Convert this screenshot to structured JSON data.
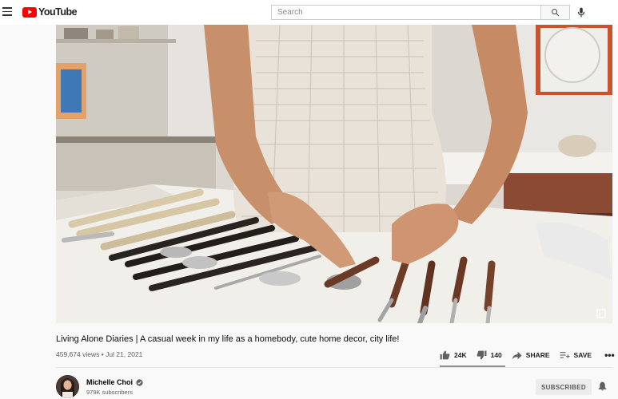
{
  "header": {
    "logo_text": "YouTube",
    "search_placeholder": "Search"
  },
  "video": {
    "title": "Living Alone Diaries | A casual week in my life as a homebody, cute home decor, city life!",
    "views": "459,674 views",
    "separator": "•",
    "date": "Jul 21, 2021"
  },
  "actions": {
    "likes": "24K",
    "dislikes": "140",
    "share": "SHARE",
    "save": "SAVE",
    "more": "•••"
  },
  "channel": {
    "name": "Michelle Choi",
    "subscribers": "979K subscribers",
    "subscribe_label": "SUBSCRIBED"
  },
  "colors": {
    "brand": "#ff0000",
    "background": "#f9f9f9",
    "secondary_text": "#606060"
  }
}
